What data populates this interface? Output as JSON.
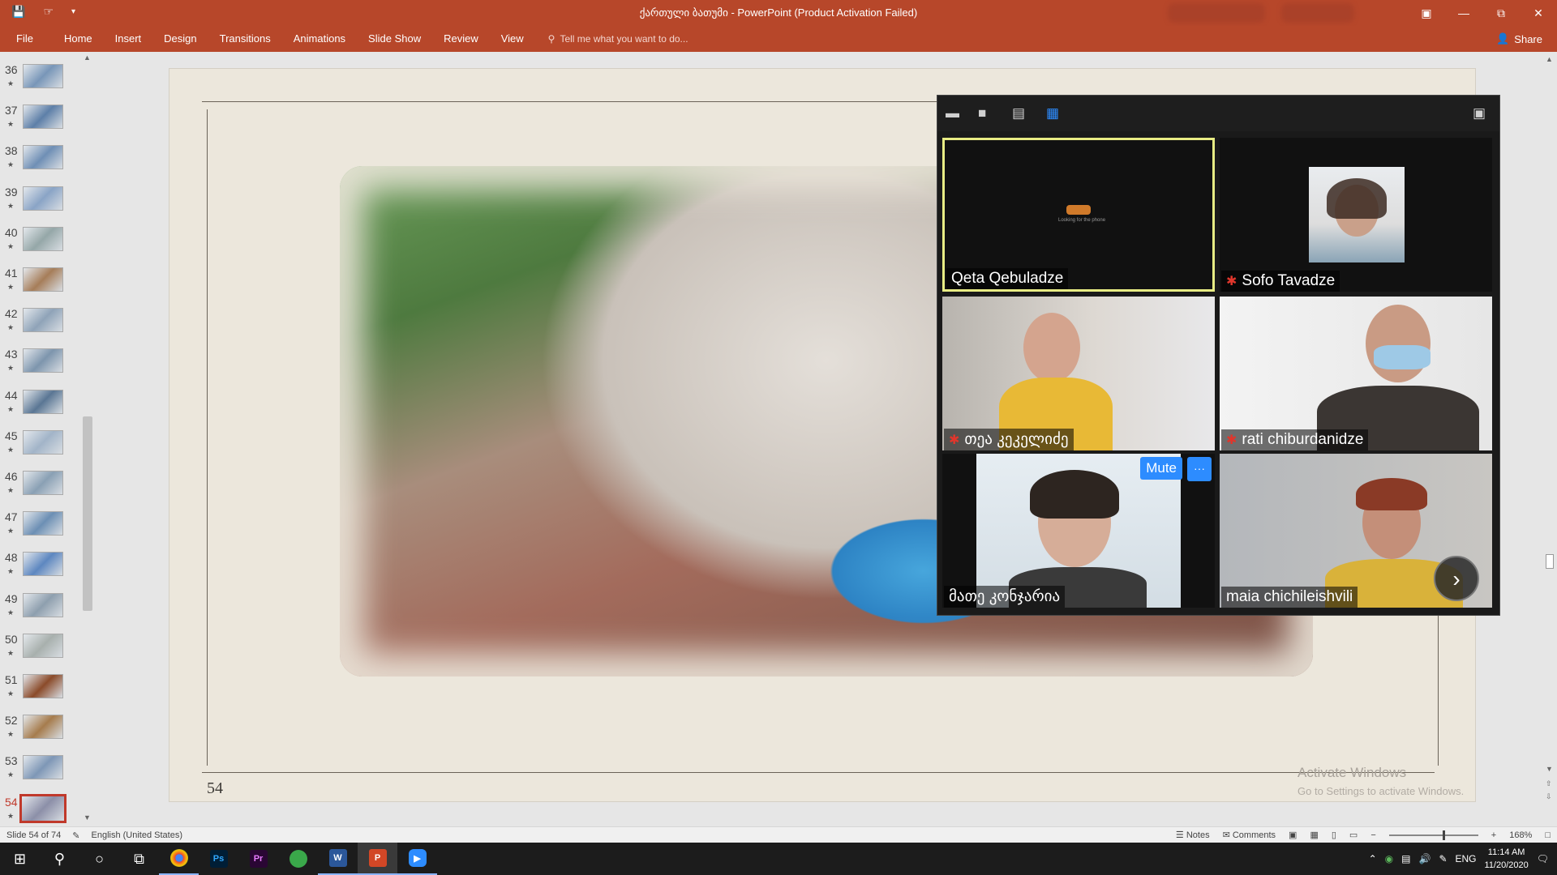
{
  "window": {
    "title": "ქართული ბათუმი - PowerPoint (Product Activation Failed)",
    "controls": [
      "restore-ribbon",
      "minimize",
      "restore",
      "close"
    ]
  },
  "quick_access": [
    "save-icon",
    "touch-mode-icon",
    "customize-icon"
  ],
  "ribbon": {
    "file": "File",
    "tabs": [
      "Home",
      "Insert",
      "Design",
      "Transitions",
      "Animations",
      "Slide Show",
      "Review",
      "View"
    ],
    "tell_me": "Tell me what you want to do...",
    "share": "Share"
  },
  "thumbnails": {
    "items": [
      {
        "num": "36"
      },
      {
        "num": "37"
      },
      {
        "num": "38"
      },
      {
        "num": "39"
      },
      {
        "num": "40"
      },
      {
        "num": "41"
      },
      {
        "num": "42"
      },
      {
        "num": "43"
      },
      {
        "num": "44"
      },
      {
        "num": "45"
      },
      {
        "num": "46"
      },
      {
        "num": "47"
      },
      {
        "num": "48"
      },
      {
        "num": "49"
      },
      {
        "num": "50"
      },
      {
        "num": "51"
      },
      {
        "num": "52"
      },
      {
        "num": "53"
      },
      {
        "num": "54"
      }
    ],
    "active": "54",
    "star": "★"
  },
  "slide": {
    "number": "54",
    "watermark_title": "Activate Windows",
    "watermark_sub": "Go to Settings to activate Windows."
  },
  "zoom": {
    "participants": [
      {
        "name": "Qeta Qebuladze",
        "muted": false,
        "active": true
      },
      {
        "name": "Sofo Tavadze",
        "muted": true,
        "active": false
      },
      {
        "name": "თეა კეკელიძე",
        "muted": true,
        "active": false
      },
      {
        "name": "rati chiburdanidze",
        "muted": true,
        "active": false
      },
      {
        "name": "მათე კონჯარია",
        "muted": false,
        "active": false
      },
      {
        "name": "maia chichileishvili",
        "muted": false,
        "active": false
      }
    ],
    "mute_label": "Mute",
    "more_label": "···",
    "next_label": "›",
    "tile_caption": "Looking for the phone"
  },
  "statusbar": {
    "slide_info": "Slide 54 of 74",
    "language": "English (United States)",
    "notes": "Notes",
    "comments": "Comments",
    "zoom_level": "168%"
  },
  "taskbar": {
    "apps": [
      "start-icon",
      "search-icon",
      "cortana-icon",
      "task-view-icon",
      "chrome-icon",
      "photoshop-icon",
      "premiere-icon",
      "green-app-icon",
      "word-icon",
      "powerpoint-icon",
      "zoom-icon"
    ],
    "lang": "ENG",
    "time": "11:14 AM",
    "date": "11/20/2020"
  }
}
